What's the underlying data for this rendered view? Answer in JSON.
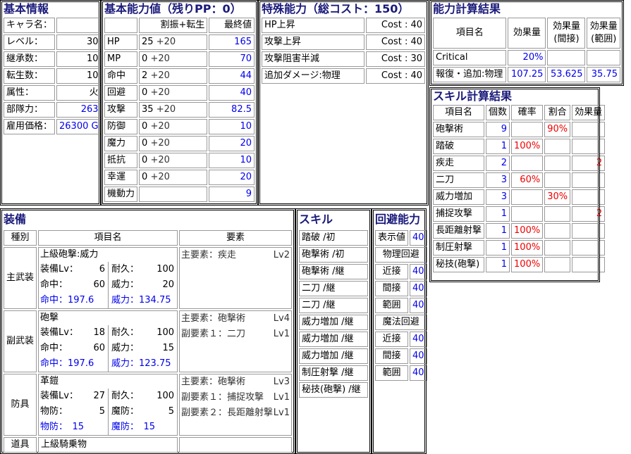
{
  "basic": {
    "title": "基本情報",
    "rows": [
      {
        "label": "キャラ名：",
        "value": ""
      },
      {
        "label": "レベル：",
        "value": "30"
      },
      {
        "label": "継承数：",
        "value": "10"
      },
      {
        "label": "転生数：",
        "value": "10"
      },
      {
        "label": "属性：",
        "value": "火"
      },
      {
        "label": "部隊力：",
        "value": "263"
      },
      {
        "label": "雇用価格：",
        "value": "26300 G"
      }
    ]
  },
  "stats": {
    "title": "基本能力値（残りPP：0）",
    "header": {
      "alloc": "割振+転生",
      "final": "最終値"
    },
    "rows": [
      {
        "name": "HP",
        "base": "25",
        "bonus": "+20",
        "final": "165"
      },
      {
        "name": "MP",
        "base": "0",
        "bonus": "+20",
        "final": "70"
      },
      {
        "name": "命中",
        "base": "2",
        "bonus": "+20",
        "final": "44"
      },
      {
        "name": "回避",
        "base": "0",
        "bonus": "+20",
        "final": "40"
      },
      {
        "name": "攻撃",
        "base": "35",
        "bonus": "+20",
        "final": "82.5"
      },
      {
        "name": "防御",
        "base": "0",
        "bonus": "+20",
        "final": "10"
      },
      {
        "name": "魔力",
        "base": "0",
        "bonus": "+20",
        "final": "20"
      },
      {
        "name": "抵抗",
        "base": "0",
        "bonus": "+20",
        "final": "10"
      },
      {
        "name": "幸運",
        "base": "0",
        "bonus": "+20",
        "final": "20"
      },
      {
        "name": "機動力",
        "base": "",
        "bonus": "",
        "final": "9"
      }
    ]
  },
  "special": {
    "title": "特殊能力（総コスト：150）",
    "rows": [
      {
        "name": "HP上昇",
        "cost": "Cost : 40"
      },
      {
        "name": "攻撃上昇",
        "cost": "Cost : 40"
      },
      {
        "name": "攻撃阻害半減",
        "cost": "Cost : 30"
      },
      {
        "name": "追加ダメージ:物理",
        "cost": "Cost : 40"
      }
    ]
  },
  "calc": {
    "title": "能力計算結果",
    "headers": [
      "項目名",
      "効果量",
      "効果量\n(間接)",
      "効果量\n(範囲)"
    ],
    "h1": "項目名",
    "h2": "効果量",
    "h3a": "効果量",
    "h3b": "(間接)",
    "h4a": "効果量",
    "h4b": "(範囲)",
    "rows": [
      {
        "name": "Critical",
        "v1": "20%",
        "v2": "",
        "v3": ""
      },
      {
        "name": "報復・追加:物理",
        "v1": "107.25",
        "v2": "53.625",
        "v3": "35.75"
      }
    ]
  },
  "skillcalc": {
    "title": "スキル計算結果",
    "headers": {
      "name": "項目名",
      "count": "個数",
      "rate": "確率",
      "ratio": "割合",
      "effect": "効果量"
    },
    "rows": [
      {
        "name": "砲撃術",
        "count": "9",
        "rate": "",
        "ratio": "90%",
        "effect": ""
      },
      {
        "name": "踏破",
        "count": "1",
        "rate": "100%",
        "ratio": "",
        "effect": ""
      },
      {
        "name": "疾走",
        "count": "2",
        "rate": "",
        "ratio": "",
        "effect": "2"
      },
      {
        "name": "二刀",
        "count": "3",
        "rate": "60%",
        "ratio": "",
        "effect": ""
      },
      {
        "name": "威力増加",
        "count": "3",
        "rate": "",
        "ratio": "30%",
        "effect": ""
      },
      {
        "name": "捕捉攻撃",
        "count": "1",
        "rate": "",
        "ratio": "",
        "effect": "2"
      },
      {
        "name": "長距離射撃",
        "count": "1",
        "rate": "100%",
        "ratio": "",
        "effect": ""
      },
      {
        "name": "制圧射撃",
        "count": "1",
        "rate": "100%",
        "ratio": "",
        "effect": ""
      },
      {
        "name": "秘技(砲撃)",
        "count": "1",
        "rate": "100%",
        "ratio": "",
        "effect": ""
      }
    ]
  },
  "equip": {
    "title": "装備",
    "headers": {
      "type": "種別",
      "item": "項目名",
      "elem": "要素"
    },
    "main": {
      "type": "主武装",
      "name": "上級砲撃:威力",
      "lvLabel": "装備Lv：",
      "lv": "6",
      "durLabel": "耐久：",
      "dur": "100",
      "hitLabel": "命中：",
      "hit": "60",
      "powLabel": "威力：",
      "pow": "20",
      "hitTotal": "命中：197.6",
      "powTotal": "威力：134.75",
      "elems": [
        {
          "text": "主要素：疾走",
          "lv": "Lv2"
        }
      ]
    },
    "sub": {
      "type": "副武装",
      "name": "砲撃",
      "lvLabel": "装備Lv：",
      "lv": "18",
      "durLabel": "耐久：",
      "dur": "100",
      "hitLabel": "命中：",
      "hit": "60",
      "powLabel": "威力：",
      "pow": "15",
      "hitTotal": "命中：197.6",
      "powTotal": "威力：123.75",
      "elems": [
        {
          "text": "主要素：砲撃術",
          "lv": "Lv4"
        },
        {
          "text": "副要素１：二刀",
          "lv": "Lv1"
        }
      ]
    },
    "armor": {
      "type": "防具",
      "name": "革鎧",
      "lvLabel": "装備Lv：",
      "lv": "27",
      "durLabel": "耐久：",
      "dur": "100",
      "defLabel": "物防：",
      "def": "5",
      "mdefLabel": "魔防：",
      "mdef": "5",
      "defTotal": "物防：　15",
      "mdefTotal": "魔防：　15",
      "elems": [
        {
          "text": "主要素：砲撃術",
          "lv": "Lv3"
        },
        {
          "text": "副要素１：捕捉攻撃",
          "lv": "Lv1"
        },
        {
          "text": "副要素２：長距離射撃",
          "lv": "Lv1"
        }
      ]
    },
    "tool": {
      "type": "道具",
      "name": "上級騎乗物"
    }
  },
  "skills": {
    "title": "スキル",
    "items": [
      "踏破 /初",
      "砲撃術 /初",
      "砲撃術 /継",
      "二刀 /継",
      "二刀 /継",
      "威力増加 /継",
      "威力増加 /継",
      "威力増加 /継",
      "制圧射撃 /継",
      "秘技(砲撃) /継"
    ]
  },
  "evasion": {
    "title": "回避能力",
    "rows": [
      {
        "label": "表示値",
        "value": "40"
      },
      {
        "label": "物理回避",
        "value": ""
      },
      {
        "label": "近接",
        "value": "40"
      },
      {
        "label": "間接",
        "value": "40"
      },
      {
        "label": "範囲",
        "value": "40"
      },
      {
        "label": "魔法回避",
        "value": ""
      },
      {
        "label": "近接",
        "value": "40"
      },
      {
        "label": "間接",
        "value": "40"
      },
      {
        "label": "範囲",
        "value": "40"
      }
    ]
  }
}
